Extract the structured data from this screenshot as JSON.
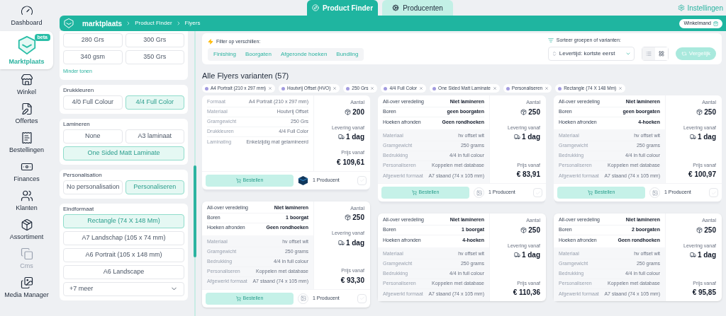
{
  "nav": [
    {
      "label": "Dashboard",
      "selected": false,
      "disabled": false
    },
    {
      "label": "Marktplaats",
      "selected": true,
      "disabled": false,
      "badge": "beta"
    },
    {
      "label": "Winkel",
      "selected": false,
      "disabled": false
    },
    {
      "label": "Offertes",
      "selected": false,
      "disabled": false
    },
    {
      "label": "Bestellingen",
      "selected": false,
      "disabled": false
    },
    {
      "label": "Finances",
      "selected": false,
      "disabled": false
    },
    {
      "label": "Klanten",
      "selected": false,
      "disabled": false
    },
    {
      "label": "Assortiment",
      "selected": false,
      "disabled": false
    },
    {
      "label": "Cms",
      "selected": false,
      "disabled": true
    },
    {
      "label": "Media Manager",
      "selected": false,
      "disabled": false
    }
  ],
  "tabs": [
    {
      "label": "Product Finder",
      "selected": true
    },
    {
      "label": "Producenten",
      "selected": false
    }
  ],
  "settings_link": "Instellingen",
  "breadcrumb": [
    "marktplaats",
    "Product Finder",
    "Flyers"
  ],
  "cart_button": "Winkelmand",
  "filter_groups": [
    {
      "options": [
        {
          "label": "280 Grs",
          "selected": false,
          "wide": false
        },
        {
          "label": "300 Grs",
          "selected": false,
          "wide": false
        },
        {
          "label": "340 gsm",
          "selected": false,
          "wide": false
        },
        {
          "label": "350 Grs",
          "selected": false,
          "wide": false
        }
      ],
      "footer_link": "Minder tonen"
    },
    {
      "title": "Drukkleuren",
      "options": [
        {
          "label": "4/0 Full Colour",
          "selected": false,
          "wide": false
        },
        {
          "label": "4/4 Full Color",
          "selected": true,
          "wide": false
        }
      ]
    },
    {
      "title": "Lamineren",
      "options": [
        {
          "label": "None",
          "selected": false,
          "wide": false
        },
        {
          "label": "A3 laminaat",
          "selected": false,
          "wide": false
        },
        {
          "label": "One Sided Matt Laminate",
          "selected": true,
          "wide": true
        }
      ]
    },
    {
      "title": "Personalisation",
      "options": [
        {
          "label": "No personalisation",
          "selected": false,
          "wide": false
        },
        {
          "label": "Personaliseren",
          "selected": true,
          "wide": false
        }
      ]
    },
    {
      "title": "Eindformaat",
      "options": [
        {
          "label": "Rectangle (74 X 148 Mm)",
          "selected": true,
          "wide": true
        },
        {
          "label": "A7 Landschap (105 x 74 mm)",
          "selected": false,
          "wide": true
        },
        {
          "label": "A6 Portrait (105 x 148 mm)",
          "selected": false,
          "wide": true
        },
        {
          "label": "A6 Landscape",
          "selected": false,
          "wide": true
        }
      ],
      "more": "+7 meer"
    }
  ],
  "filter_bar": {
    "label": "Filter op verschillen:",
    "chips": [
      "Finishing",
      "Boorgaten",
      "Afgeronde hoeken",
      "Bundling"
    ]
  },
  "sort": {
    "label": "Sorteer groepen of varianten:",
    "value": "Levertijd: kortste eerst"
  },
  "view_modes": [
    {
      "kind": "list",
      "selected": false
    },
    {
      "kind": "grid",
      "selected": true
    }
  ],
  "compare_button": "Vergelijk",
  "results_title": "Alle Flyers varianten (57)",
  "active_tags": [
    "A4 Portrait (210 x 297 mm)",
    "Houtvrij Offset (HVO)",
    "250 Grs",
    "4/4 Full Color",
    "One Sided Matt Laminate",
    "Personaliseren",
    "Rectangle (74 X 148 Mm)"
  ],
  "columns": [
    {
      "cards": [
        {
          "stacked": true,
          "specs": [
            {
              "label": "Formaat",
              "value": "A4 Portrait (210 x 297 mm)"
            },
            {
              "label": "Materiaal",
              "value": "Houtvrij Offset"
            },
            {
              "label": "Gramgewicht",
              "value": "250 Grs"
            },
            {
              "label": "Drukkleuren",
              "value": "4/4 Full Color"
            },
            {
              "label": "Laminating",
              "value": "Enkelzijdig mat gelamineerd"
            }
          ],
          "quantity_label": "Aantal",
          "quantity": "200",
          "delivery_label": "Levering vanaf",
          "delivery": "1 dag",
          "price_label": "Prijs vanaf",
          "price": "€ 109,61",
          "footer": {
            "button": "Bestellen",
            "kind": "cube",
            "producers": "1 Producent",
            "checked": false
          }
        },
        {
          "highlights": [
            {
              "label": "All-over veredeling",
              "value": "Niet lamineren"
            },
            {
              "label": "Boren",
              "value": "1 boorgat"
            },
            {
              "label": "Hoeken afronden",
              "value": "Geen rondhoeken"
            }
          ],
          "specs": [
            {
              "label": "Materiaal",
              "value": "hv offset wit"
            },
            {
              "label": "Gramgewicht",
              "value": "250 grams"
            },
            {
              "label": "Bedrukking",
              "value": "4/4 in full colour"
            },
            {
              "label": "Personaliseren",
              "value": "Koppelen met database"
            },
            {
              "label": "Afgewerkt formaat",
              "value": "A7 staand (74 x 105 mm)"
            }
          ],
          "quantity_label": "Aantal",
          "quantity": "250",
          "delivery_label": "Levering vanaf",
          "delivery": "1 dag",
          "price_label": "Prijs vanaf",
          "price": "€ 93,30",
          "footer": {
            "button": "Bestellen",
            "kind": "placeholder",
            "producers": "1 Producent",
            "checked": false
          }
        }
      ]
    },
    {
      "cards": [
        {
          "stacked": true,
          "highlights": [
            {
              "label": "All-over veredeling",
              "value": "Niet lamineren"
            },
            {
              "label": "Boren",
              "value": "geen boorgaten"
            },
            {
              "label": "Hoeken afronden",
              "value": "Geen rondhoeken"
            }
          ],
          "specs": [
            {
              "label": "Materiaal",
              "value": "hv offset wit"
            },
            {
              "label": "Gramgewicht",
              "value": "250 grams"
            },
            {
              "label": "Bedrukking",
              "value": "4/4 in full colour"
            },
            {
              "label": "Personaliseren",
              "value": "Koppelen met database"
            },
            {
              "label": "Afgewerkt formaat",
              "value": "A7 staand (74 x 105 mm)"
            }
          ],
          "quantity_label": "Aantal",
          "quantity": "250",
          "delivery_label": "Levering vanaf",
          "delivery": "1 dag",
          "price_label": "Prijs vanaf",
          "price": "€ 83,91",
          "footer": {
            "button": "Bestellen",
            "kind": "placeholder",
            "producers": "1 Producent",
            "checked": false
          }
        },
        {
          "highlights": [
            {
              "label": "All-over veredeling",
              "value": "Niet lamineren"
            },
            {
              "label": "Boren",
              "value": "1 boorgat"
            },
            {
              "label": "Hoeken afronden",
              "value": "4-hoeken"
            }
          ],
          "specs": [
            {
              "label": "Materiaal",
              "value": "hv offset wit"
            },
            {
              "label": "Gramgewicht",
              "value": "250 grams"
            },
            {
              "label": "Bedrukking",
              "value": "4/4 in full colour"
            },
            {
              "label": "Personaliseren",
              "value": "Koppelen met database"
            },
            {
              "label": "Afgewerkt formaat",
              "value": "A7 staand (74 x 105 mm)"
            }
          ],
          "quantity_label": "Aantal",
          "quantity": "250",
          "delivery_label": "Levering vanaf",
          "delivery": "1 dag",
          "price_label": "Prijs vanaf",
          "price": "€ 110,36"
        }
      ]
    },
    {
      "cards": [
        {
          "stacked": true,
          "highlights": [
            {
              "label": "All-over veredeling",
              "value": "Niet lamineren"
            },
            {
              "label": "Boren",
              "value": "geen boorgaten"
            },
            {
              "label": "Hoeken afronden",
              "value": "4-hoeken"
            }
          ],
          "specs": [
            {
              "label": "Materiaal",
              "value": "hv offset wit"
            },
            {
              "label": "Gramgewicht",
              "value": "250 grams"
            },
            {
              "label": "Bedrukking",
              "value": "4/4 in full colour"
            },
            {
              "label": "Personaliseren",
              "value": "Koppelen met database"
            },
            {
              "label": "Afgewerkt formaat",
              "value": "A7 staand (74 x 105 mm)"
            }
          ],
          "quantity_label": "Aantal",
          "quantity": "250",
          "delivery_label": "Levering vanaf",
          "delivery": "1 dag",
          "price_label": "Prijs vanaf",
          "price": "€ 100,97",
          "footer": {
            "button": "Bestellen",
            "kind": "placeholder",
            "producers": "1 Producent",
            "checked": false
          }
        },
        {
          "highlights": [
            {
              "label": "All-over veredeling",
              "value": "Niet lamineren"
            },
            {
              "label": "Boren",
              "value": "2 boorgaten"
            },
            {
              "label": "Hoeken afronden",
              "value": "Geen rondhoeken"
            }
          ],
          "specs": [
            {
              "label": "Materiaal",
              "value": "hv offset wit"
            },
            {
              "label": "Gramgewicht",
              "value": "250 grams"
            },
            {
              "label": "Bedrukking",
              "value": "4/4 in full colour"
            },
            {
              "label": "Personaliseren",
              "value": "Koppelen met database"
            },
            {
              "label": "Afgewerkt formaat",
              "value": "A7 staand (74 x 105 mm)"
            }
          ],
          "quantity_label": "Aantal",
          "quantity": "250",
          "delivery_label": "Levering vanaf",
          "delivery": "1 dag",
          "price_label": "Prijs vanaf",
          "price": "€ 95,85"
        }
      ]
    }
  ]
}
